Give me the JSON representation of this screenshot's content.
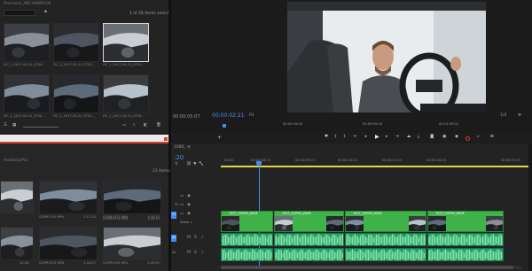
{
  "project_panel": {
    "project_name": "Premiere_ARCHAWAY18",
    "items_selected": "1 of 28 items selected",
    "items": [
      {
        "label": "FIC_1_2017-04-21_0724..."
      },
      {
        "label": "FIC_1_2017-04-21_0720..."
      },
      {
        "label": "FIC_1_2017-04-21_0720..."
      },
      {
        "label": "FIC_1_2017-04-21_0720..."
      },
      {
        "label": "FIC_1_2017-04-21_0720..."
      },
      {
        "label": "FIC_1_2017-04-21_0720..."
      }
    ]
  },
  "media_browser": {
    "folder": "mediaGoPro",
    "items_count": "21 Items",
    "items": [
      {
        "label": "",
        "duration": ""
      },
      {
        "label": "GOPR1970.MP4",
        "duration": "1:11:15"
      },
      {
        "label": "GOPR1971.MP4",
        "duration": "1:05:23"
      },
      {
        "label": "GOPR1973.MP4",
        "duration": "1:24:34"
      },
      {
        "label": "",
        "duration": "24:18"
      },
      {
        "label": "GOPR1975.MP4",
        "duration": "1:18:17"
      },
      {
        "label": "GOPR1976.MP4",
        "duration": "1:09:20"
      }
    ]
  },
  "source_monitor": {
    "timecode": "00:00:05:07"
  },
  "program_monitor": {
    "timecode": "00:00:02:21",
    "fit_label": "Fit",
    "page": "1/4",
    "ruler": [
      "00:04:59:16",
      "00:09:59:16",
      "00:14:59:02"
    ]
  },
  "timeline": {
    "tab_label": "1080_",
    "playhead_time": ":20",
    "ruler": [
      "00:00",
      "00:00:04:23",
      "00:00:09:23",
      "00:00:14:23",
      "00:00:19:23",
      "00:00:24:23",
      "00:00:29:23"
    ],
    "track_labels": {
      "v2": "V2",
      "v1": "V1",
      "video_name": "Video 1",
      "a1": "A1",
      "a2": "A2"
    },
    "clips": [
      {
        "label": "TEST_GOPR0_WIDE"
      },
      {
        "label": "TEST_GOPR0_WIDE"
      },
      {
        "label": "TEST_GOPR0_WIDE"
      },
      {
        "label": "TEST_GOPR0_WIDE"
      }
    ],
    "colors": {
      "clip_green": "#3fb24a",
      "audio_green": "#1f9e63",
      "playhead": "#3d8df2",
      "workarea": "#e8d24a"
    }
  }
}
